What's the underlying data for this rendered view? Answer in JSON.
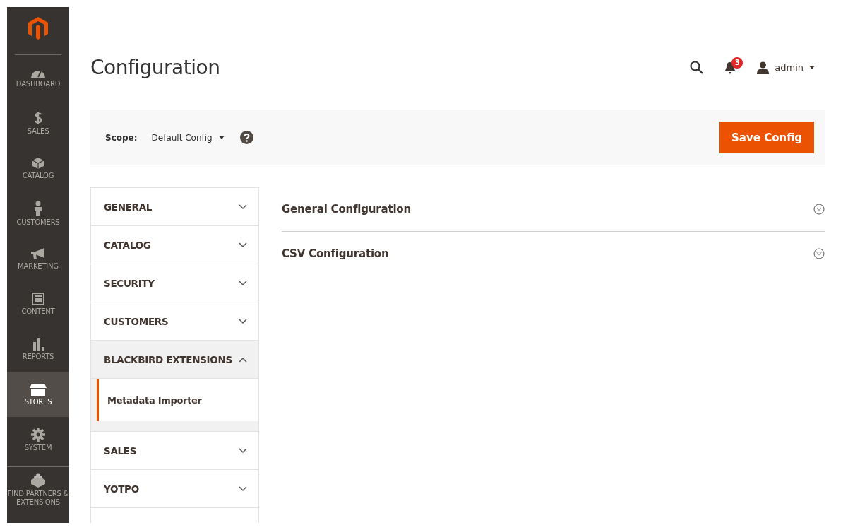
{
  "menu": {
    "items": [
      {
        "label": "DASHBOARD",
        "selected": false
      },
      {
        "label": "SALES",
        "selected": false
      },
      {
        "label": "CATALOG",
        "selected": false
      },
      {
        "label": "CUSTOMERS",
        "selected": false
      },
      {
        "label": "MARKETING",
        "selected": false
      },
      {
        "label": "CONTENT",
        "selected": false
      },
      {
        "label": "REPORTS",
        "selected": false
      },
      {
        "label": "STORES",
        "selected": true
      },
      {
        "label": "SYSTEM",
        "selected": false
      },
      {
        "label": "FIND PARTNERS & EXTENSIONS",
        "selected": false
      }
    ]
  },
  "header": {
    "title": "Configuration",
    "notifications": "3",
    "user": "admin"
  },
  "scope": {
    "label": "Scope:",
    "value": "Default Config",
    "button": "Save Config"
  },
  "tabs": [
    {
      "label": "GENERAL",
      "expanded": false
    },
    {
      "label": "CATALOG",
      "expanded": false
    },
    {
      "label": "SECURITY",
      "expanded": false
    },
    {
      "label": "CUSTOMERS",
      "expanded": false
    },
    {
      "label": "BLACKBIRD EXTENSIONS",
      "expanded": true,
      "children": [
        {
          "label": "Metadata Importer",
          "selected": true
        }
      ]
    },
    {
      "label": "SALES",
      "expanded": false
    },
    {
      "label": "YOTPO",
      "expanded": false
    }
  ],
  "sections": [
    {
      "title": "General Configuration",
      "expanded": false
    },
    {
      "title": "CSV Configuration",
      "expanded": false
    }
  ]
}
